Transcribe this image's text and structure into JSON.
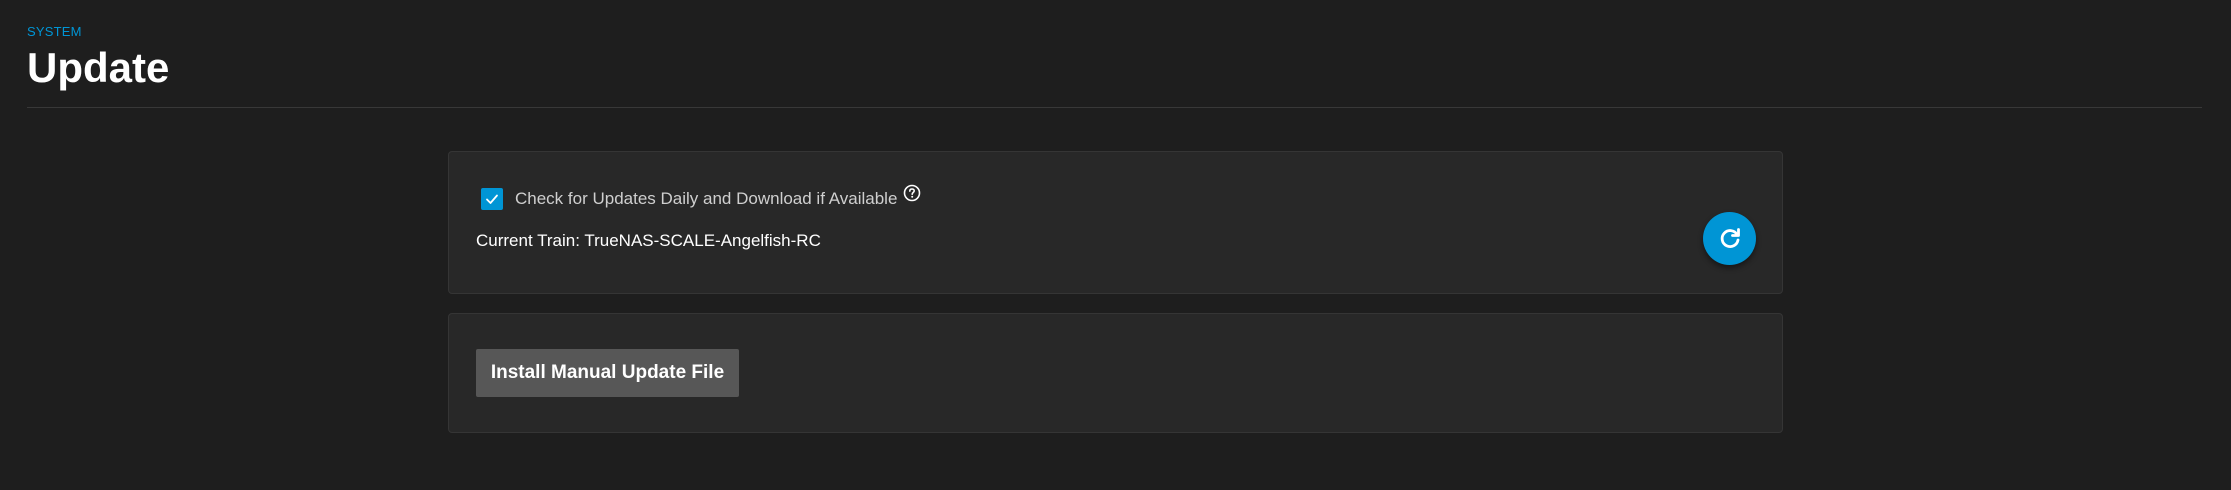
{
  "header": {
    "breadcrumb": "SYSTEM",
    "title": "Update"
  },
  "auto_update": {
    "checkbox_label": "Check for Updates Daily and Download if Available",
    "checkbox_checked": true,
    "help_icon": "help-circle-icon",
    "current_train": "Current Train: TrueNAS-SCALE-Angelfish-RC",
    "refresh_icon": "refresh-icon"
  },
  "manual_update": {
    "install_label": "Install Manual Update File"
  },
  "colors": {
    "accent": "#0095d5",
    "background": "#1e1e1e",
    "card": "#282828",
    "button": "#575757"
  }
}
